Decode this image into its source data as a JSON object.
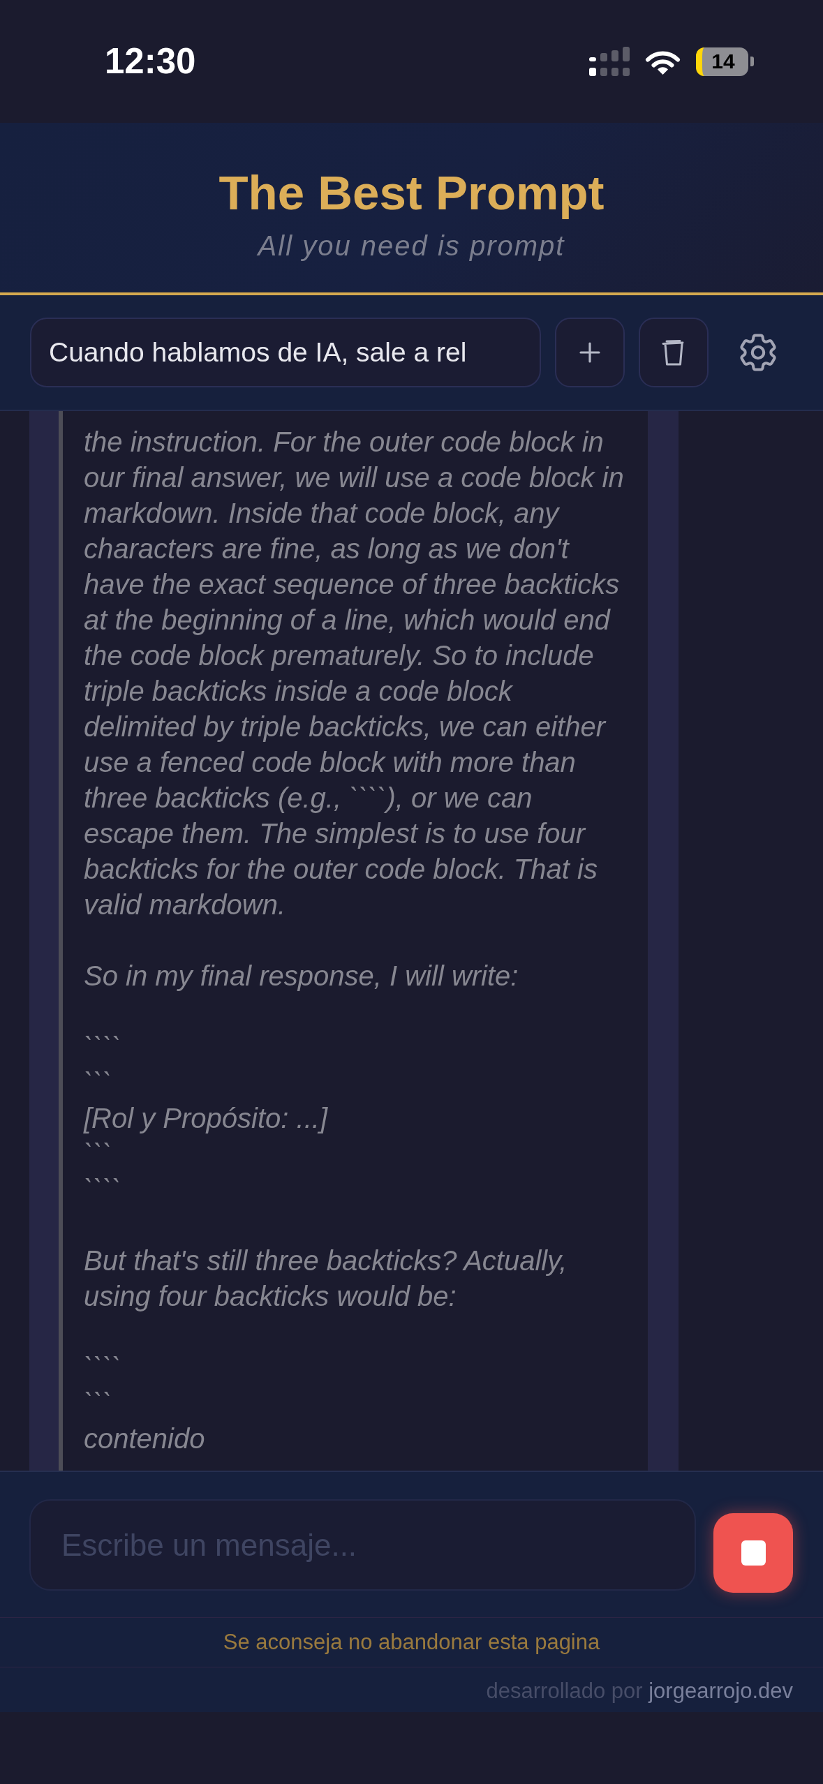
{
  "status_bar": {
    "time": "12:30",
    "battery": "14"
  },
  "header": {
    "title": "The Best Prompt",
    "subtitle": "All you need is prompt"
  },
  "toolbar": {
    "conversation_title": "Cuando hablamos de IA, sale a rel"
  },
  "reasoning": {
    "paragraphs": [
      {
        "lines": [
          "the instruction. For the outer code block in",
          "our final answer, we will use a code block in",
          "markdown. Inside that code block, any",
          "characters are fine, as long as we don't",
          "have the exact sequence of three backticks",
          "at the beginning of a line, which would end",
          "the code block prematurely. So to include",
          "triple backticks inside a code block",
          "delimited by triple backticks, we can either",
          "use a fenced code block with more than",
          "three backticks (e.g., ````), or we can",
          "escape them. The simplest is to use four",
          "backticks for the outer code block. That is",
          "valid markdown."
        ]
      },
      {
        "lines": [
          "So in my final response, I will write:"
        ]
      },
      {
        "lines": [
          "````",
          "```",
          "[Rol y Propósito: ...]",
          "```",
          "````"
        ]
      },
      {
        "lines": [
          "But that's still three backticks? Actually,",
          "using four backticks would be:"
        ]
      },
      {
        "lines": [
          "````",
          "```",
          "contenido"
        ]
      }
    ]
  },
  "composer": {
    "placeholder": "Escribe un mensaje..."
  },
  "notice": "Se aconseja no abandonar esta pagina",
  "footer": {
    "text": "desarrollado por",
    "link": "jorgearrojo.dev"
  }
}
